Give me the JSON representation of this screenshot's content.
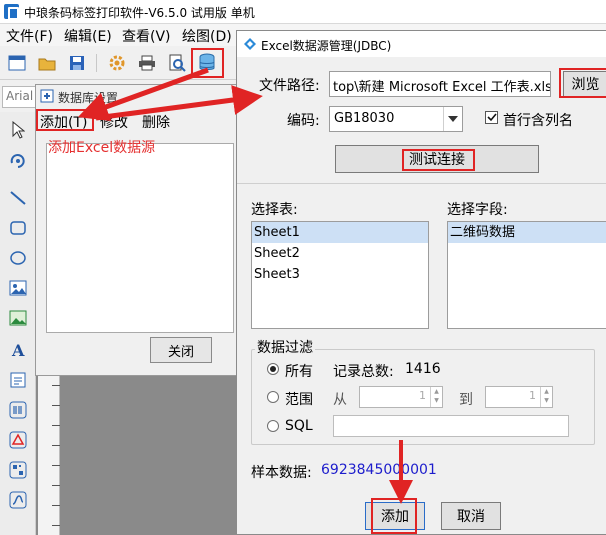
{
  "app": {
    "title": "中琅条码标签打印软件-V6.5.0 试用版 单机",
    "menu": [
      "文件(F)",
      "编辑(E)",
      "查看(V)",
      "绘图(D)"
    ],
    "font_name": "Arial"
  },
  "db_dialog": {
    "title": "数据库设置",
    "menu": {
      "add": "添加(T)",
      "modify": "修改",
      "delete": "删除"
    },
    "hint": "添加Excel数据源",
    "close_label": "关闭"
  },
  "excel_dialog": {
    "title": "Excel数据源管理(JDBC)",
    "file_path_label": "文件路径:",
    "file_path_value": "top\\新建 Microsoft Excel 工作表.xls",
    "browse_label": "浏览",
    "encoding_label": "编码:",
    "encoding_value": "GB18030",
    "header_checkbox_label": "首行含列名",
    "test_connection_label": "测试连接",
    "select_table_label": "选择表:",
    "tables": [
      "Sheet1",
      "Sheet2",
      "Sheet3"
    ],
    "select_field_label": "选择字段:",
    "fields": [
      "二维码数据"
    ],
    "filter_label": "数据过滤",
    "filter_all_label": "所有",
    "record_total_label": "记录总数:",
    "record_total_value": "1416",
    "filter_range_label": "范围",
    "range_from_label": "从",
    "range_to_label": "到",
    "range_from_value": "1",
    "range_to_value": "1",
    "filter_sql_label": "SQL",
    "sample_label": "样本数据:",
    "sample_value": "6923845000001",
    "add_label": "添加",
    "cancel_label": "取消"
  },
  "colors": {
    "highlight": "#e02424",
    "sample_text": "#1d1dcc",
    "hint_text": "#e53030"
  }
}
